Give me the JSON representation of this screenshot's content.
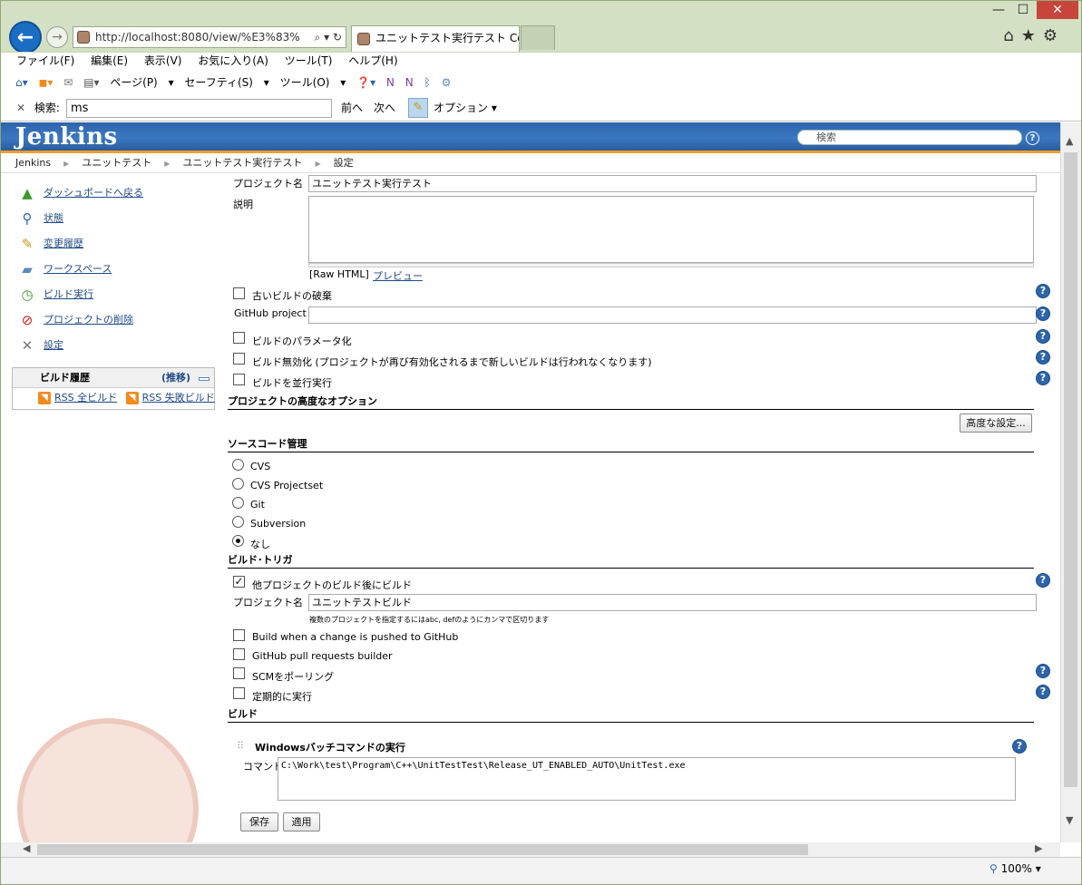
{
  "browser": {
    "address_url": "http://localhost:8080/view/%E3%83%",
    "tab_title": "ユニットテスト実行テスト Confi...",
    "window_controls": {
      "minimize": "—",
      "maximize": "☐",
      "close": "✕"
    },
    "menu": [
      "ファイル(F)",
      "編集(E)",
      "表示(V)",
      "お気に入り(A)",
      "ツール(T)",
      "ヘルプ(H)"
    ],
    "command_bar": [
      "ページ(P)",
      "セーフティ(S)",
      "ツール(O)"
    ],
    "find": {
      "close": "✕",
      "label": "検索:",
      "value": "ms",
      "prev": "前へ",
      "next": "次へ",
      "options": "オプション"
    },
    "zoom": "100%"
  },
  "jenkins": {
    "logo": "Jenkins",
    "search_placeholder": "検索",
    "breadcrumbs": [
      "Jenkins",
      "ユニットテスト",
      "ユニットテスト実行テスト",
      "設定"
    ]
  },
  "sidebar": {
    "items": [
      {
        "label": "ダッシュボードへ戻る",
        "icon": "up-arrow-icon"
      },
      {
        "label": "状態",
        "icon": "magnifier-icon"
      },
      {
        "label": "変更履歴",
        "icon": "notepad-icon"
      },
      {
        "label": "ワークスペース",
        "icon": "folder-icon"
      },
      {
        "label": "ビルド実行",
        "icon": "clock-icon"
      },
      {
        "label": "プロジェクトの削除",
        "icon": "no-entry-icon"
      },
      {
        "label": "設定",
        "icon": "tools-icon"
      }
    ],
    "history": {
      "title": "ビルド履歴",
      "trend": "(推移)",
      "rss_all": "RSS 全ビルド",
      "rss_failed": "RSS 失敗ビルド"
    }
  },
  "form": {
    "project_name_label": "プロジェクト名",
    "project_name_value": "ユニットテスト実行テスト",
    "description_label": "説明",
    "raw_html": "[Raw HTML]",
    "preview": "プレビュー",
    "discard_old": "古いビルドの破棄",
    "github_project": "GitHub project",
    "parameterized": "ビルドのパラメータ化",
    "disable_build": "ビルド無効化 (プロジェクトが再び有効化されるまで新しいビルドは行われなくなります)",
    "concurrent": "ビルドを並行実行",
    "advanced_options_title": "プロジェクトの高度なオプション",
    "advanced_button": "高度な設定...",
    "scm_title": "ソースコード管理",
    "scm_options": [
      "CVS",
      "CVS Projectset",
      "Git",
      "Subversion",
      "なし"
    ],
    "scm_selected": "なし",
    "triggers_title": "ビルド･トリガ",
    "trigger_after_other": "他プロジェクトのビルド後にビルド",
    "trigger_after_other_checked": true,
    "trigger_project_label": "プロジェクト名",
    "trigger_project_value": "ユニットテストビルド",
    "trigger_hint": "複数のプロジェクトを指定するにはabc, defのようにカンマで区切ります",
    "trigger_github_push": "Build when a change is pushed to GitHub",
    "trigger_github_pr": "GitHub pull requests builder",
    "trigger_scm_poll": "SCMをポーリング",
    "trigger_periodic": "定期的に実行",
    "build_title": "ビルド",
    "batch_step_title": "Windowsバッチコマンドの実行",
    "command_label": "コマンド",
    "command_value": "C:\\Work\\test\\Program\\C++\\UnitTestTest\\Release_UT_ENABLED_AUTO\\UnitTest.exe",
    "save_button": "保存",
    "apply_button": "適用"
  },
  "colors": {
    "jenkins_header": "#2d64aa",
    "header_underline": "#f29c2a",
    "link": "#204a87",
    "help_icon": "#2d64aa"
  }
}
